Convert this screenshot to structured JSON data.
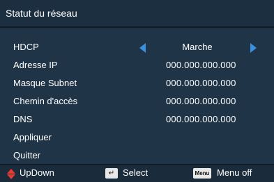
{
  "header": {
    "title": "Statut du réseau"
  },
  "menu": {
    "items": [
      {
        "label": "HDCP",
        "value": "Marche"
      },
      {
        "label": "Adresse IP",
        "value": "000.000.000.000"
      },
      {
        "label": "Masque Subnet",
        "value": "000.000.000.000"
      },
      {
        "label": "Chemin d'accès",
        "value": "000.000.000.000"
      },
      {
        "label": "DNS",
        "value": "000.000.000.000"
      },
      {
        "label": "Appliquer"
      },
      {
        "label": "Quitter"
      }
    ]
  },
  "footer": {
    "updown_label": "UpDown",
    "select_label": "Select",
    "menu_key_label": "Menu",
    "menuoff_label": "Menu off"
  },
  "colors": {
    "background": "#203447",
    "arrow": "#3a8fe0",
    "updown_arrow": "#e83a2f"
  },
  "icons": {
    "left": "arrow-left-icon",
    "right": "arrow-right-icon",
    "updown": "updown-icon",
    "enter": "enter-key-icon",
    "menu": "menu-key-icon"
  }
}
